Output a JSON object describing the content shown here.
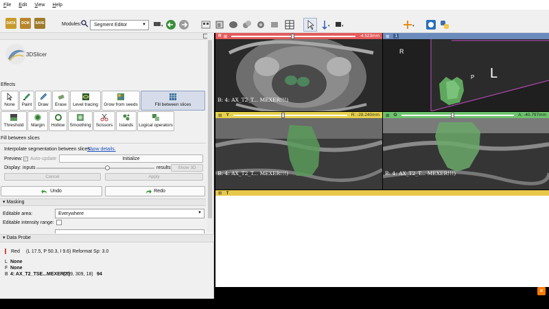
{
  "menu": [
    "File",
    "Edit",
    "View",
    "Help"
  ],
  "toolbar": {
    "data_label": "DATA",
    "dcm_label": "DCM",
    "save_label": "SAVE",
    "modules_label": "Modules:",
    "module_selected": "Segment Editor"
  },
  "logo": {
    "text": "3DSlicer"
  },
  "effects": {
    "section_label": "Effects",
    "row1": [
      "None",
      "Paint",
      "Draw",
      "Erase",
      "Level tracing",
      "Grow from seeds",
      "Fill between slices"
    ],
    "row2": [
      "Threshold",
      "Margin",
      "Hollow",
      "Smoothing",
      "Scissors",
      "Islands",
      "Logical operators"
    ]
  },
  "fill_between": {
    "header": "Fill between slices",
    "description": "Interpolate segmentation between slices... ",
    "show_details": "Show details.",
    "preview_label": "Preview:",
    "auto_update": "Auto-update",
    "initialize": "Initialize",
    "display_label": "Display:",
    "inputs": "inputs",
    "results": "results",
    "show3d": "Show 3D",
    "cancel": "Cancel",
    "apply": "Apply",
    "undo": "Undo",
    "redo": "Redo"
  },
  "masking": {
    "header": "Masking",
    "editable_area_label": "Editable area:",
    "editable_area_value": "Everywhere",
    "editable_intensity_label": "Editable intensity range:"
  },
  "probe": {
    "header": "Data Probe",
    "layer_name": "Red",
    "coords": "(L 17.5, P 50.3, I 9.6)  Reformat Sp: 3.0",
    "l_label": "L",
    "l_value": "None",
    "f_label": "F",
    "f_value": "None",
    "b_label": "B",
    "b_value": "4: AX_T2_TSE...MEXER!!!)",
    "b_coords": "(259, 309,  18)",
    "b_val": "94"
  },
  "views": {
    "red": {
      "letter": "R",
      "offset": "-4.523mm",
      "caption": "B: 4: AX_T2_T... MEXER!!!)",
      "color": "#e35b5b"
    },
    "threed": {
      "letter": "1",
      "label_R": "R",
      "label_P": "P",
      "label_L": "L",
      "color": "#6b8bbd"
    },
    "yellow": {
      "letter": "Y",
      "offset": "R: -28.240mm",
      "caption": "B: 4: AX_T2_T... MEXER!!!)",
      "color": "#e6d14a"
    },
    "green": {
      "letter": "G",
      "offset": "A: -40.797mm",
      "caption": "B: 4: AX_T2_T... MEXER!!!)",
      "color": "#6dc36d"
    },
    "bottom": {
      "letter": "T",
      "color": "#e8c84a"
    }
  }
}
